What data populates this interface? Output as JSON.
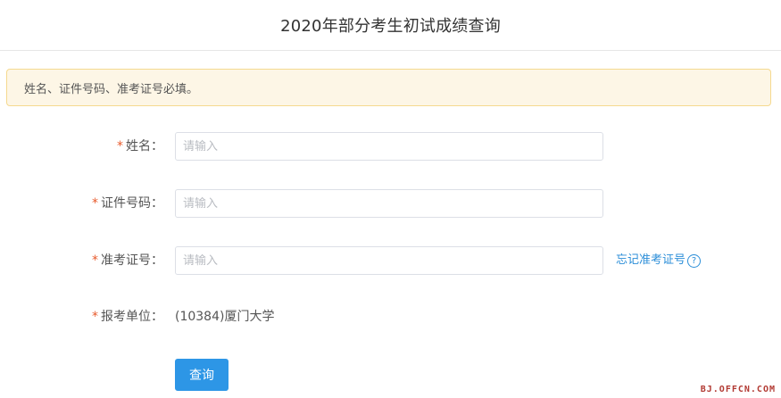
{
  "header": {
    "title": "2020年部分考生初试成绩查询"
  },
  "notice": {
    "text": "姓名、证件号码、准考证号必填。"
  },
  "form": {
    "required_mark": "*",
    "name": {
      "label": "姓名：",
      "placeholder": "请输入",
      "value": ""
    },
    "id_number": {
      "label": "证件号码：",
      "placeholder": "请输入",
      "value": ""
    },
    "exam_number": {
      "label": "准考证号：",
      "placeholder": "请输入",
      "value": "",
      "forgot_link": "忘记准考证号",
      "help_glyph": "?",
      "help_icon": "question-circle-icon"
    },
    "institution": {
      "label": "报考单位：",
      "value": "(10384)厦门大学"
    },
    "submit_label": "查询"
  },
  "watermark": {
    "text": "BJ.OFFCN.COM"
  },
  "colors": {
    "accent": "#2d96e6",
    "link": "#2b8ed8",
    "required": "#e85a2c",
    "notice_bg": "#fdf6e6",
    "notice_border": "#f5d98f"
  }
}
